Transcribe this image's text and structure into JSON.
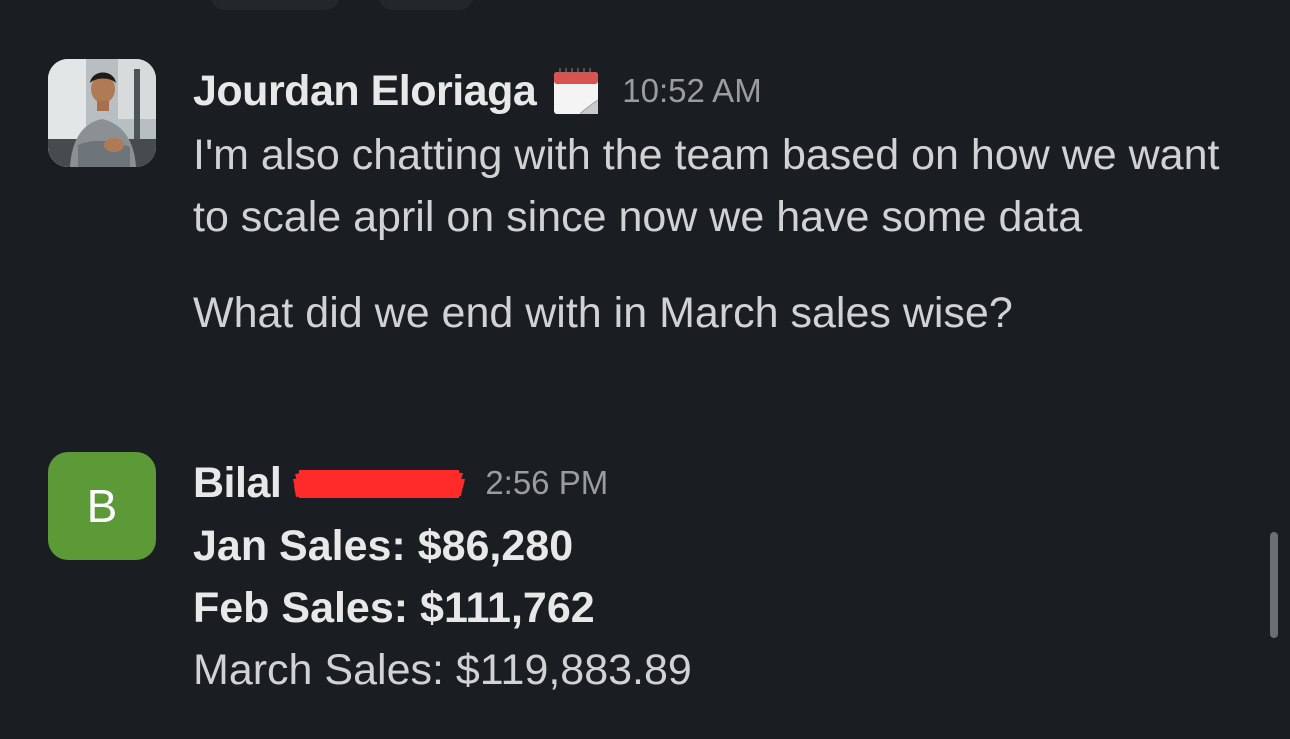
{
  "messages": [
    {
      "author": "Jourdan Eloriaga",
      "status_emoji": "calendar-icon",
      "time": "10:52 AM",
      "paragraphs": [
        "I'm also chatting with the team based on how we want to scale april on since now we have some data",
        "What did we end with in March sales wise?"
      ]
    },
    {
      "author": "Bilal",
      "avatar_letter": "B",
      "avatar_color": "#5b9a36",
      "time": "2:56 PM",
      "lines": [
        {
          "label": "Jan Sales:",
          "value": "$86,280"
        },
        {
          "label": "Feb Sales:",
          "value": "$111,762"
        },
        {
          "label": "March Sales:",
          "value": "$119,883.89"
        }
      ]
    }
  ],
  "colors": {
    "background": "#1a1d21",
    "text": "#d1d2d3",
    "timestamp": "#9a9c9f",
    "redaction": "#ff2a2a"
  }
}
